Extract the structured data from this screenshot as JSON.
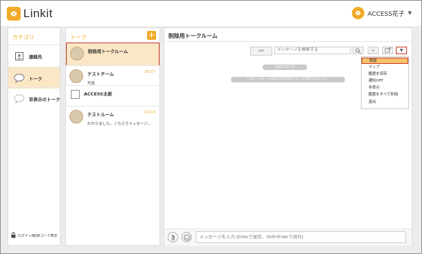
{
  "app": {
    "brand": "Linkit"
  },
  "user": {
    "name": "ACCESS花子"
  },
  "categories": {
    "title": "カテゴリ",
    "items": [
      {
        "label": "連絡先"
      },
      {
        "label": "トーク"
      },
      {
        "label": "非表示のトーク"
      }
    ],
    "qr_login": "ログイン用QRコード表示"
  },
  "talks": {
    "title": "トーク",
    "add_label": "+",
    "items": [
      {
        "name": "削除用トークルーム",
        "sub": "",
        "time": ""
      },
      {
        "name": "テストチーム",
        "sub": "写真",
        "time": "16:07"
      },
      {
        "name": "ACCESS太郎",
        "sub": "",
        "time": ""
      },
      {
        "name": "テストルーム",
        "sub": "わかりました。こちらでメッセージ...",
        "time": "02/16"
      }
    ]
  },
  "chat": {
    "title": "削除用トークルーム",
    "search_placeholder": "メッセージを検索する",
    "date": "2023.02.17",
    "system_message": "このトークルームはACCESS花子によって作成されました。",
    "input_placeholder": "メッセージを入力 (Enterで送信、Shift+Enterで改行)",
    "nav_arrows": "◀ ▶",
    "add_label": "+"
  },
  "menu": {
    "items": [
      "情報",
      "マップ",
      "履歴を保存",
      "通知OFF",
      "非表示",
      "履歴をすべて削除",
      "退出"
    ],
    "selected_index": 0
  },
  "colors": {
    "accent": "#f1a927",
    "highlight": "#fbe7c6",
    "selection_outline": "#c8321e"
  }
}
